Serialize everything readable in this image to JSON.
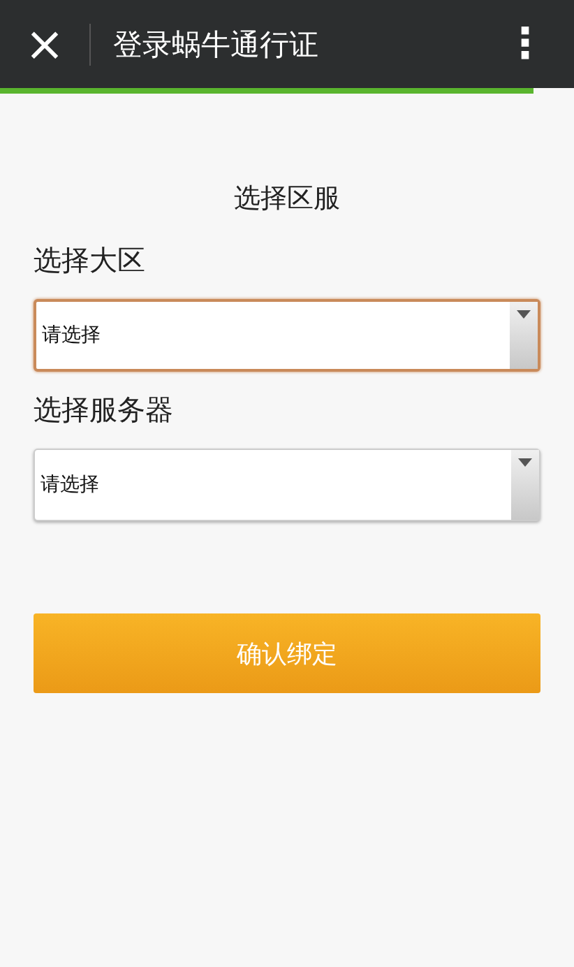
{
  "title_bar": {
    "close": "×",
    "title": "登录蜗牛通行证",
    "menu": "⋮"
  },
  "progress": {
    "level": 0.93
  },
  "form": {
    "heading": "选择区服",
    "fields": [
      {
        "label": "选择大区",
        "value": "请选择",
        "focused": true
      },
      {
        "label": "选择服务器",
        "value": "请选择",
        "focused": false
      }
    ],
    "submit": "确认绑定"
  }
}
